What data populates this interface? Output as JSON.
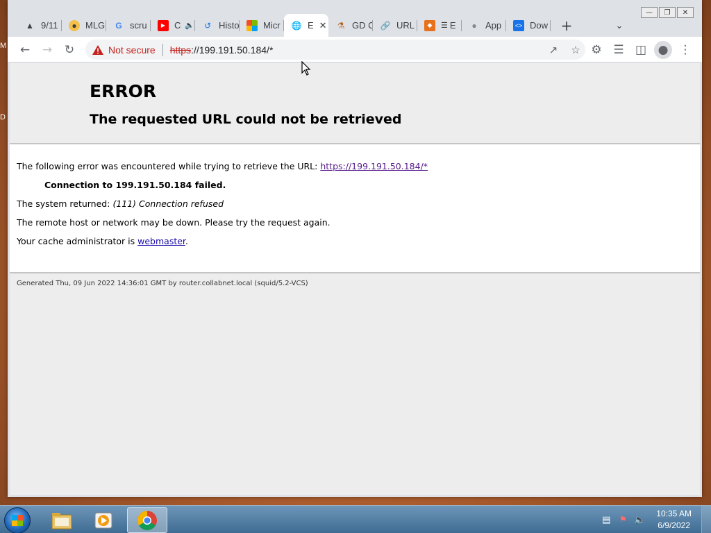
{
  "desktop": {
    "edge_labels": [
      "M",
      "D"
    ]
  },
  "tabs": [
    {
      "label": "9/11",
      "icon": "tower-icon"
    },
    {
      "label": "MLG",
      "icon": "doge-icon"
    },
    {
      "label": "scru",
      "icon": "google-icon"
    },
    {
      "label": "C",
      "icon": "youtube-icon",
      "audio": "speaker-icon"
    },
    {
      "label": "Histo",
      "icon": "history-icon"
    },
    {
      "label": "Micr",
      "icon": "microsoft-icon"
    },
    {
      "label": "E",
      "icon": "globe-icon",
      "active": true
    },
    {
      "label": "GD C",
      "icon": "flask-icon"
    },
    {
      "label": "URL",
      "icon": "link-icon"
    },
    {
      "label": "E",
      "icon": "badge-icon"
    },
    {
      "label": "App",
      "icon": "apple-icon"
    },
    {
      "label": "Dow",
      "icon": "code-icon"
    }
  ],
  "toolbar": {
    "security_label": "Not secure",
    "url_scheme": "https",
    "url_rest": "://199.191.50.184/*"
  },
  "page": {
    "title": "ERROR",
    "subtitle": "The requested URL could not be retrieved",
    "line1_prefix": "The following error was encountered while trying to retrieve the URL:",
    "line1_link": "https://199.191.50.184/*",
    "line2": "Connection to 199.191.50.184 failed.",
    "line3_prefix": "The system returned:",
    "line3_italic": "(111) Connection refused",
    "line4": "The remote host or network may be down. Please try the request again.",
    "line5_prefix": "Your cache administrator is",
    "line5_link": "webmaster",
    "line5_suffix": ".",
    "footer": "Generated Thu, 09 Jun 2022 14:36:01 GMT by router.collabnet.local (squid/5.2-VCS)"
  },
  "taskbar": {
    "apps": [
      "file-explorer-icon",
      "media-player-icon",
      "chrome-icon"
    ],
    "time": "10:35 AM",
    "date": "6/9/2022"
  },
  "colors": {
    "accent": "#1a73e8",
    "warning": "#c5221f",
    "link": "#1a0dab",
    "visited": "#551a8b"
  }
}
